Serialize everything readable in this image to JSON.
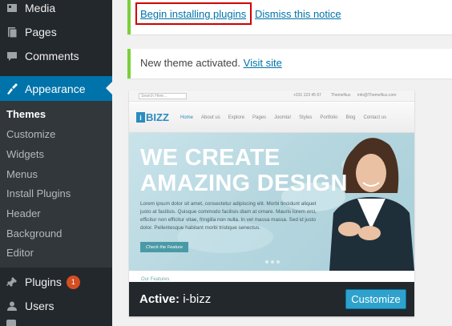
{
  "sidebar": {
    "menu": [
      {
        "label": "Media",
        "icon": "media-icon"
      },
      {
        "label": "Pages",
        "icon": "pages-icon"
      },
      {
        "label": "Comments",
        "icon": "comments-icon"
      },
      {
        "label": "Appearance",
        "icon": "appearance-icon"
      },
      {
        "label": "Plugins",
        "icon": "plugins-icon",
        "badge": "1"
      },
      {
        "label": "Users",
        "icon": "users-icon"
      }
    ],
    "submenu": [
      "Themes",
      "Customize",
      "Widgets",
      "Menus",
      "Install Plugins",
      "Header",
      "Background",
      "Editor"
    ],
    "colors": {
      "bg": "#23282d",
      "current": "#0073aa",
      "submenu_bg": "#32373c"
    }
  },
  "notice1": {
    "begin_installing": "Begin installing plugins",
    "dismiss": "Dismiss this notice"
  },
  "notice2": {
    "message": "New theme activated.",
    "visit_site": "Visit site"
  },
  "theme": {
    "screenshot": {
      "search_placeholder": "Search Here...",
      "phone": "+231 123 45 67",
      "brand_small": "ThemeNux",
      "email": "info@ThemeNux.com",
      "logo_mark": "i",
      "logo_text": "BIZZ",
      "nav": [
        "Home",
        "About us",
        "Explore",
        "Pages",
        "Joomla!",
        "Styles",
        "Portfolio",
        "Blog",
        "Contact us"
      ],
      "headline_1": "WE CREATE",
      "headline_2": "AMAZING DESIGN",
      "body": "Lorem ipsum dolor sit amet, consectetur adipiscing elit. Morbi tincidunt aliquet justo at facilisis. Quisque commodo facilisis diam at ornare. Mauris lorem orci, efficitur non efficitur vitae, fringilla non nulla. In vel massa massa. Sed id justo dolor. Pellentesque habitant morbi tristique senectus.",
      "cta": "Check the Feature",
      "features": "Our Features"
    },
    "active_prefix": "Active:",
    "name": "i-bizz",
    "customize": "Customize"
  }
}
